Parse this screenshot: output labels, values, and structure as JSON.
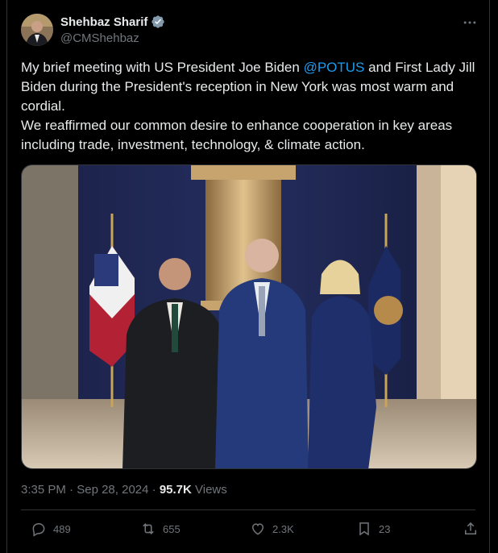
{
  "author": {
    "name": "Shehbaz Sharif",
    "handle": "@CMShehbaz"
  },
  "tweet": {
    "text_line1": "My brief meeting with US President Joe Biden ",
    "mention": "@POTUS",
    "text_line1_rest": " and First Lady Jill Biden during the President's reception in New York was most warm and cordial.\nWe reaffirmed our common desire to enhance cooperation in key areas including trade, investment, technology, & climate action."
  },
  "meta": {
    "time": "3:35 PM",
    "sep": " · ",
    "date": "Sep 28, 2024",
    "sep2": " · ",
    "views_count": "95.7K",
    "views_label": " Views"
  },
  "actions": {
    "replies": "489",
    "reposts": "655",
    "likes": "2.3K",
    "bookmarks": "23"
  },
  "colors": {
    "accent": "#1d9bf0",
    "muted": "#71767b",
    "text": "#e7e9ea",
    "bg": "#000000"
  }
}
